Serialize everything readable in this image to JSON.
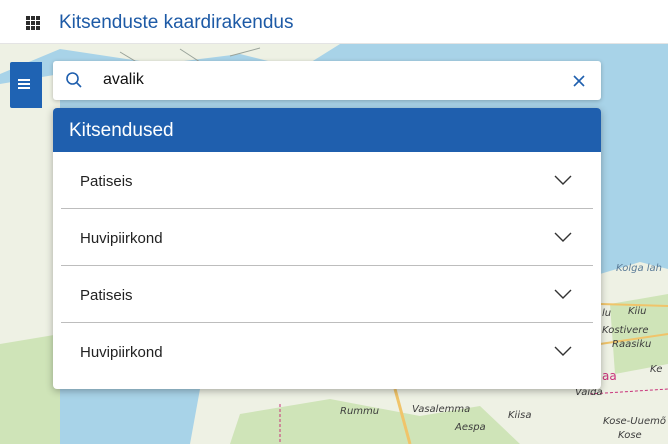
{
  "header": {
    "title": "Kitsenduste kaardirakendus",
    "menu_icon": "apps-grid-icon"
  },
  "search": {
    "value": "avalik",
    "search_icon": "search-icon",
    "clear_icon": "close-icon"
  },
  "sidebar": {
    "toggle_icon": "indent-list-icon"
  },
  "results": {
    "title": "Kitsendused",
    "items": [
      {
        "label": "Patiseis"
      },
      {
        "label": "Huvipiirkond"
      },
      {
        "label": "Patiseis"
      },
      {
        "label": "Huvipiirkond"
      }
    ]
  },
  "map": {
    "labels": [
      "Kolga lah",
      "Kiiu",
      "Kostivere",
      "Raasiku",
      "Ke",
      "Vaida",
      "Rummu",
      "Vasalemma",
      "Kiisa",
      "Aespa",
      "Kose-Uuemõ",
      "Kose",
      "aa",
      "lu"
    ],
    "colors": {
      "sea": "#a8d3e8",
      "land": "#eef1e4",
      "forest": "#cfe4b8",
      "road": "#f0c46a"
    }
  },
  "colors": {
    "accent": "#1f5fae",
    "title": "#1d5aa6"
  }
}
